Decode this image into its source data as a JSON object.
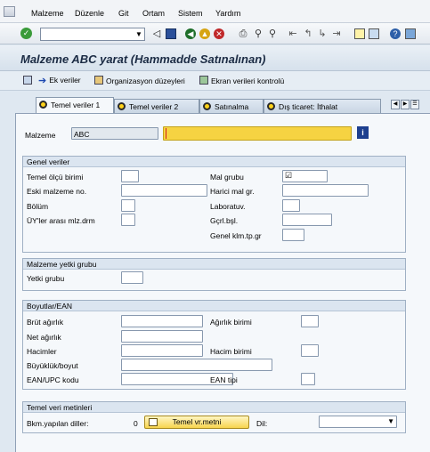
{
  "menu": {
    "items": [
      {
        "label": "Malzeme"
      },
      {
        "label": "Düzenle"
      },
      {
        "label": "Git"
      },
      {
        "label": "Ortam"
      },
      {
        "label": "Sistem"
      },
      {
        "label": "Yardım"
      }
    ]
  },
  "toolbar": {
    "command_value": "",
    "icons": [
      "enter-icon",
      "back-icon",
      "save-icon",
      "back-arrow-icon",
      "exit-icon",
      "cancel-icon",
      "print-icon",
      "find-icon",
      "find-next-icon",
      "first-page-icon",
      "prev-page-icon",
      "next-page-icon",
      "last-page-icon",
      "new-session-icon",
      "shortcut-icon",
      "help-icon",
      "customize-icon"
    ]
  },
  "title": "Malzeme ABC yarat (Hammadde Satınalınan)",
  "app_toolbar": {
    "additional_data": "Ek veriler",
    "org_levels": "Organizasyon düzeyleri",
    "check_screen": "Ekran verileri kontrolü"
  },
  "tabs": [
    {
      "label": "Temel veriler 1",
      "active": true
    },
    {
      "label": "Temel veriler 2",
      "active": false
    },
    {
      "label": "Satınalma",
      "active": false
    },
    {
      "label": "Dış ticaret: İthalat",
      "active": false
    }
  ],
  "material": {
    "label": "Malzeme",
    "code": "ABC",
    "description": ""
  },
  "general": {
    "title": "Genel veriler",
    "base_uom": "Temel ölçü birimi",
    "old_material": "Eski malzeme no.",
    "division": "Bölüm",
    "x_plant_status": "ÜY'ler arası mlz.drm",
    "material_group": "Mal grubu",
    "material_group_value": "☑",
    "ext_material_group": "Harici mal gr.",
    "lab_office": "Laboratuv.",
    "validity": "Gçrl.bşl.",
    "gen_item_cat": "Genel klm.tp.gr"
  },
  "authorization": {
    "title": "Malzeme yetki grubu",
    "auth_group": "Yetki grubu"
  },
  "dimensions": {
    "title": "Boyutlar/EAN",
    "gross_weight": "Brüt ağırlık",
    "net_weight": "Net ağırlık",
    "volume": "Hacimler",
    "size_dim": "Büyüklük/boyut",
    "ean_upc": "EAN/UPC kodu",
    "weight_unit": "Ağırlık birimi",
    "volume_unit": "Hacim birimi",
    "ean_type": "EAN tipi"
  },
  "texts": {
    "title": "Temel veri metinleri",
    "languages_label": "Bkm.yapılan diller:",
    "languages_count": "0",
    "button": "Temel vr.metni",
    "lang_label": "Dil:",
    "lang_value": ""
  }
}
